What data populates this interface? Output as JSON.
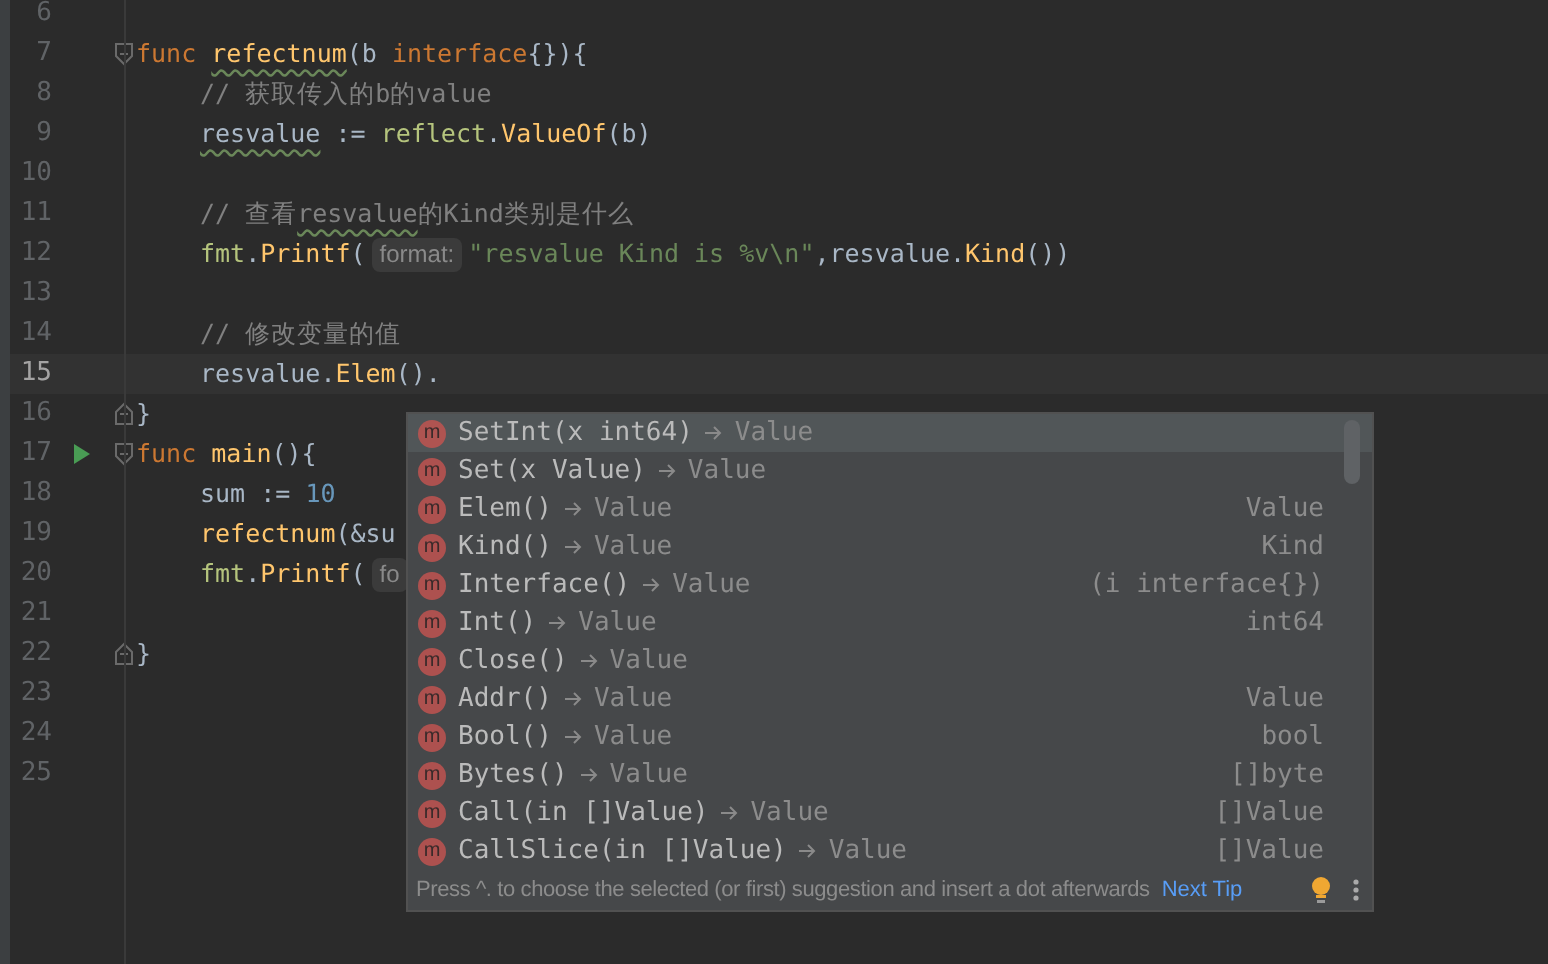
{
  "editor": {
    "lines": [
      {
        "number": "6"
      },
      {
        "number": "7",
        "fold_start": true,
        "tokens": [
          {
            "kind": "keyword",
            "text": "func "
          },
          {
            "kind": "decl",
            "text": "refectnum",
            "warning": true
          },
          {
            "kind": "plain",
            "text": "(b "
          },
          {
            "kind": "keyword",
            "text": "interface"
          },
          {
            "kind": "plain",
            "text": "{}){"
          }
        ]
      },
      {
        "number": "8",
        "indented": true,
        "tokens": [
          {
            "kind": "comment",
            "text": "// 获取传入的b的value"
          }
        ]
      },
      {
        "number": "9",
        "indented": true,
        "tokens": [
          {
            "kind": "plain",
            "text": "resvalue",
            "warning": true
          },
          {
            "kind": "plain",
            "text": " := "
          },
          {
            "kind": "package",
            "text": "reflect"
          },
          {
            "kind": "plain",
            "text": "."
          },
          {
            "kind": "call",
            "text": "ValueOf"
          },
          {
            "kind": "plain",
            "text": "(b)"
          }
        ]
      },
      {
        "number": "10"
      },
      {
        "number": "11",
        "indented": true,
        "tokens": [
          {
            "kind": "comment",
            "text": "// 查看"
          },
          {
            "kind": "comment",
            "text": "resvalue",
            "warning": true
          },
          {
            "kind": "comment",
            "text": "的Kind类别是什么"
          }
        ]
      },
      {
        "number": "12",
        "indented": true,
        "tokens": [
          {
            "kind": "package",
            "text": "fmt"
          },
          {
            "kind": "plain",
            "text": "."
          },
          {
            "kind": "call",
            "text": "Printf"
          },
          {
            "kind": "plain",
            "text": "("
          },
          {
            "kind": "hint",
            "text": "format:"
          },
          {
            "kind": "string",
            "text": "\"resvalue Kind is %v\\n\""
          },
          {
            "kind": "plain",
            "text": ",resvalue."
          },
          {
            "kind": "call",
            "text": "Kind"
          },
          {
            "kind": "plain",
            "text": "())"
          }
        ]
      },
      {
        "number": "13"
      },
      {
        "number": "14",
        "indented": true,
        "tokens": [
          {
            "kind": "comment",
            "text": "// 修改变量的值"
          }
        ]
      },
      {
        "number": "15",
        "current": true,
        "indented": true,
        "tokens": [
          {
            "kind": "plain",
            "text": "resvalue."
          },
          {
            "kind": "call",
            "text": "Elem"
          },
          {
            "kind": "plain",
            "text": "()."
          }
        ]
      },
      {
        "number": "16",
        "fold_end": true,
        "tokens": [
          {
            "kind": "plain",
            "text": "}"
          }
        ]
      },
      {
        "number": "17",
        "fold_start": true,
        "run": true,
        "tokens": [
          {
            "kind": "keyword",
            "text": "func "
          },
          {
            "kind": "decl",
            "text": "main"
          },
          {
            "kind": "plain",
            "text": "(){"
          }
        ]
      },
      {
        "number": "18",
        "indented": true,
        "tokens": [
          {
            "kind": "plain",
            "text": "sum := "
          },
          {
            "kind": "number",
            "text": "10"
          }
        ]
      },
      {
        "number": "19",
        "indented": true,
        "tokens": [
          {
            "kind": "call",
            "text": "refectnum"
          },
          {
            "kind": "plain",
            "text": "(&su"
          }
        ]
      },
      {
        "number": "20",
        "indented": true,
        "tokens": [
          {
            "kind": "package",
            "text": "fmt"
          },
          {
            "kind": "plain",
            "text": "."
          },
          {
            "kind": "call",
            "text": "Printf"
          },
          {
            "kind": "plain",
            "text": "("
          },
          {
            "kind": "hint",
            "text": "fo"
          }
        ]
      },
      {
        "number": "21"
      },
      {
        "number": "22",
        "fold_end": true,
        "tokens": [
          {
            "kind": "plain",
            "text": "}"
          }
        ]
      },
      {
        "number": "23"
      },
      {
        "number": "24"
      },
      {
        "number": "25"
      }
    ]
  },
  "completion": {
    "items": [
      {
        "icon": "m",
        "name": "SetInt(x int64)",
        "type": "Value",
        "selected": true
      },
      {
        "icon": "m",
        "name": "Set(x Value)",
        "type": "Value",
        "selected": false
      },
      {
        "icon": "m",
        "name": "Elem()",
        "type": "Value",
        "tail": "Value",
        "selected": false
      },
      {
        "icon": "m",
        "name": "Kind()",
        "type": "Value",
        "tail": "Kind",
        "selected": false
      },
      {
        "icon": "m",
        "name": "Interface()",
        "type": "Value",
        "tail": "(i interface{})",
        "selected": false
      },
      {
        "icon": "m",
        "name": "Int()",
        "type": "Value",
        "tail": "int64",
        "selected": false
      },
      {
        "icon": "m",
        "name": "Close()",
        "type": "Value",
        "selected": false
      },
      {
        "icon": "m",
        "name": "Addr()",
        "type": "Value",
        "tail": "Value",
        "selected": false
      },
      {
        "icon": "m",
        "name": "Bool()",
        "type": "Value",
        "tail": "bool",
        "selected": false
      },
      {
        "icon": "m",
        "name": "Bytes()",
        "type": "Value",
        "tail": "[]byte",
        "selected": false
      },
      {
        "icon": "m",
        "name": "Call(in []Value)",
        "type": "Value",
        "tail": "[]Value",
        "selected": false
      },
      {
        "icon": "m",
        "name": "CallSlice(in []Value)",
        "type": "Value",
        "tail": "[]Value",
        "selected": false
      }
    ],
    "footer": {
      "hint": "Press ^. to choose the selected (or first) suggestion and insert a dot afterwards",
      "link": "Next Tip"
    }
  }
}
